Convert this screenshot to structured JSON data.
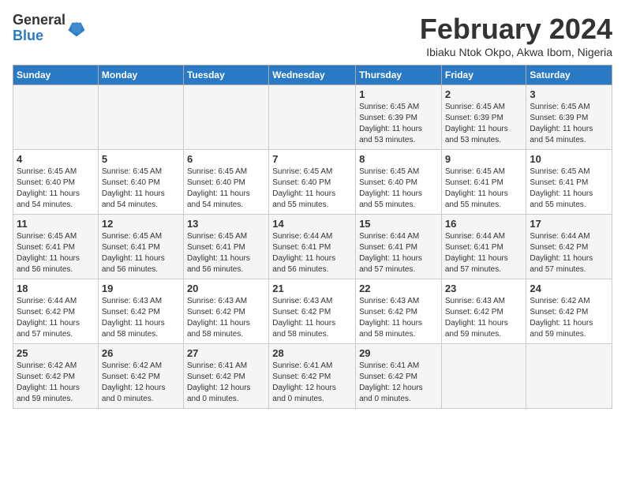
{
  "header": {
    "logo_general": "General",
    "logo_blue": "Blue",
    "month": "February 2024",
    "location": "Ibiaku Ntok Okpo, Akwa Ibom, Nigeria"
  },
  "weekdays": [
    "Sunday",
    "Monday",
    "Tuesday",
    "Wednesday",
    "Thursday",
    "Friday",
    "Saturday"
  ],
  "weeks": [
    [
      {
        "day": "",
        "detail": ""
      },
      {
        "day": "",
        "detail": ""
      },
      {
        "day": "",
        "detail": ""
      },
      {
        "day": "",
        "detail": ""
      },
      {
        "day": "1",
        "detail": "Sunrise: 6:45 AM\nSunset: 6:39 PM\nDaylight: 11 hours\nand 53 minutes."
      },
      {
        "day": "2",
        "detail": "Sunrise: 6:45 AM\nSunset: 6:39 PM\nDaylight: 11 hours\nand 53 minutes."
      },
      {
        "day": "3",
        "detail": "Sunrise: 6:45 AM\nSunset: 6:39 PM\nDaylight: 11 hours\nand 54 minutes."
      }
    ],
    [
      {
        "day": "4",
        "detail": "Sunrise: 6:45 AM\nSunset: 6:40 PM\nDaylight: 11 hours\nand 54 minutes."
      },
      {
        "day": "5",
        "detail": "Sunrise: 6:45 AM\nSunset: 6:40 PM\nDaylight: 11 hours\nand 54 minutes."
      },
      {
        "day": "6",
        "detail": "Sunrise: 6:45 AM\nSunset: 6:40 PM\nDaylight: 11 hours\nand 54 minutes."
      },
      {
        "day": "7",
        "detail": "Sunrise: 6:45 AM\nSunset: 6:40 PM\nDaylight: 11 hours\nand 55 minutes."
      },
      {
        "day": "8",
        "detail": "Sunrise: 6:45 AM\nSunset: 6:40 PM\nDaylight: 11 hours\nand 55 minutes."
      },
      {
        "day": "9",
        "detail": "Sunrise: 6:45 AM\nSunset: 6:41 PM\nDaylight: 11 hours\nand 55 minutes."
      },
      {
        "day": "10",
        "detail": "Sunrise: 6:45 AM\nSunset: 6:41 PM\nDaylight: 11 hours\nand 55 minutes."
      }
    ],
    [
      {
        "day": "11",
        "detail": "Sunrise: 6:45 AM\nSunset: 6:41 PM\nDaylight: 11 hours\nand 56 minutes."
      },
      {
        "day": "12",
        "detail": "Sunrise: 6:45 AM\nSunset: 6:41 PM\nDaylight: 11 hours\nand 56 minutes."
      },
      {
        "day": "13",
        "detail": "Sunrise: 6:45 AM\nSunset: 6:41 PM\nDaylight: 11 hours\nand 56 minutes."
      },
      {
        "day": "14",
        "detail": "Sunrise: 6:44 AM\nSunset: 6:41 PM\nDaylight: 11 hours\nand 56 minutes."
      },
      {
        "day": "15",
        "detail": "Sunrise: 6:44 AM\nSunset: 6:41 PM\nDaylight: 11 hours\nand 57 minutes."
      },
      {
        "day": "16",
        "detail": "Sunrise: 6:44 AM\nSunset: 6:41 PM\nDaylight: 11 hours\nand 57 minutes."
      },
      {
        "day": "17",
        "detail": "Sunrise: 6:44 AM\nSunset: 6:42 PM\nDaylight: 11 hours\nand 57 minutes."
      }
    ],
    [
      {
        "day": "18",
        "detail": "Sunrise: 6:44 AM\nSunset: 6:42 PM\nDaylight: 11 hours\nand 57 minutes."
      },
      {
        "day": "19",
        "detail": "Sunrise: 6:43 AM\nSunset: 6:42 PM\nDaylight: 11 hours\nand 58 minutes."
      },
      {
        "day": "20",
        "detail": "Sunrise: 6:43 AM\nSunset: 6:42 PM\nDaylight: 11 hours\nand 58 minutes."
      },
      {
        "day": "21",
        "detail": "Sunrise: 6:43 AM\nSunset: 6:42 PM\nDaylight: 11 hours\nand 58 minutes."
      },
      {
        "day": "22",
        "detail": "Sunrise: 6:43 AM\nSunset: 6:42 PM\nDaylight: 11 hours\nand 58 minutes."
      },
      {
        "day": "23",
        "detail": "Sunrise: 6:43 AM\nSunset: 6:42 PM\nDaylight: 11 hours\nand 59 minutes."
      },
      {
        "day": "24",
        "detail": "Sunrise: 6:42 AM\nSunset: 6:42 PM\nDaylight: 11 hours\nand 59 minutes."
      }
    ],
    [
      {
        "day": "25",
        "detail": "Sunrise: 6:42 AM\nSunset: 6:42 PM\nDaylight: 11 hours\nand 59 minutes."
      },
      {
        "day": "26",
        "detail": "Sunrise: 6:42 AM\nSunset: 6:42 PM\nDaylight: 12 hours\nand 0 minutes."
      },
      {
        "day": "27",
        "detail": "Sunrise: 6:41 AM\nSunset: 6:42 PM\nDaylight: 12 hours\nand 0 minutes."
      },
      {
        "day": "28",
        "detail": "Sunrise: 6:41 AM\nSunset: 6:42 PM\nDaylight: 12 hours\nand 0 minutes."
      },
      {
        "day": "29",
        "detail": "Sunrise: 6:41 AM\nSunset: 6:42 PM\nDaylight: 12 hours\nand 0 minutes."
      },
      {
        "day": "",
        "detail": ""
      },
      {
        "day": "",
        "detail": ""
      }
    ]
  ]
}
